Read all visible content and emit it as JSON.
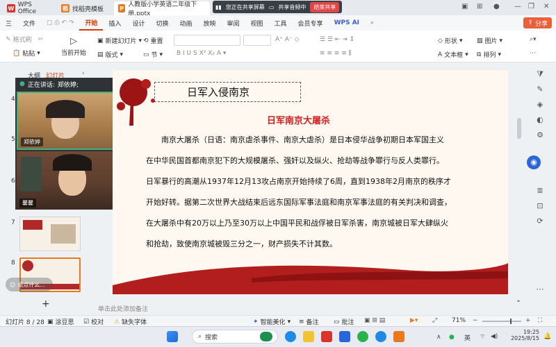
{
  "window": {
    "tabs": [
      {
        "label": "WPS Office",
        "icon_color": "#d9342b"
      },
      {
        "label": "找稻壳模板",
        "icon_color": "#e8791e"
      },
      {
        "label": "人教版小学英语二年级下册.pptx",
        "icon_color": "#e8791e"
      }
    ],
    "sharing": {
      "screen_label": "您正在共享屏幕",
      "audio_label": "共享音频中",
      "end_label": "结束共享"
    },
    "share_button": "分享"
  },
  "ribbon": {
    "tabs": [
      "三",
      "文件",
      "开始",
      "插入",
      "设计",
      "切换",
      "动画",
      "放映",
      "审阅",
      "视图",
      "工具",
      "会员专享",
      "WPS AI"
    ],
    "active_tab": "开始"
  },
  "toolbar": {
    "format_painter": "格式刷",
    "paste": "粘贴",
    "play_from_current": "当前开始",
    "new_slide": "新建幻灯片",
    "layout": "版式",
    "reset": "重置",
    "section": "节",
    "shape": "形状",
    "image": "图片",
    "textbox": "文本框",
    "arrange": "排列"
  },
  "left_panel": {
    "tab_outline": "大纲",
    "tab_slides": "幻灯片",
    "slide_numbers": [
      "4",
      "5",
      "6",
      "7",
      "8"
    ],
    "add_label": "+"
  },
  "video": {
    "speaking_label": "正在讲话:",
    "speaker_name": "郑依婷;",
    "participants": [
      {
        "name": "郑依婷"
      },
      {
        "name": "馨馨"
      }
    ],
    "chat_placeholder": "说点什么..."
  },
  "slide": {
    "title": "日军入侵南京",
    "heading": "日军南京大屠杀",
    "paragraphs": [
      "南京大屠杀（日语：南京虐杀事件、南京大虐杀）是日本侵华战争初期日本军国主义",
      "在中华民国首都南京犯下的大规模屠杀、强奸以及纵火、抢劫等战争罪行与反人类罪行。",
      "日军暴行的高潮从1937年12月13攻占南京开始持续了6周，直到1938年2月南京的秩序才",
      "开始好转。据第二次世界大战结束后远东国际军事法庭和南京军事法庭的有关判决和调查，",
      "在大屠杀中有20万以上乃至30万以上中国平民和战俘被日军杀害，南京城被日军大肆纵火",
      "和抢劫，致使南京城被毁三分之一，财产损失不计其数。"
    ],
    "heading_color": "#d02020"
  },
  "notes": {
    "placeholder": "单击此处添加备注"
  },
  "status_bar": {
    "slide_info": "幻灯片 8 / 28",
    "theme": "涂豆思",
    "proofread": "校对",
    "missing_font": "缺失字体",
    "smart_beautify": "智能美化",
    "notes_btn": "备注",
    "comments_btn": "批注",
    "zoom": "71%"
  },
  "taskbar": {
    "search_placeholder": "搜索",
    "ime": "英",
    "time": "19:25",
    "date": "2025/8/15"
  }
}
